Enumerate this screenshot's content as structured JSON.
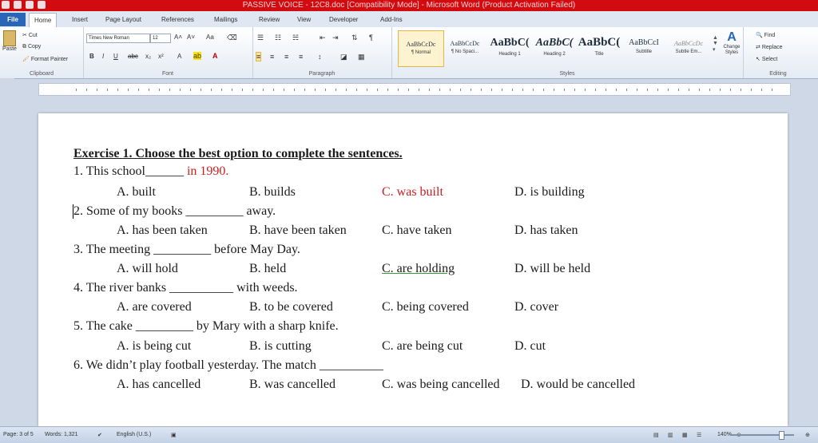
{
  "window": {
    "title": "PASSIVE VOICE - 12C8.doc [Compatibility Mode] - Microsoft Word (Product Activation Failed)"
  },
  "tabs": [
    "File",
    "Home",
    "Insert",
    "Page Layout",
    "References",
    "Mailings",
    "Review",
    "View",
    "Developer",
    "Add-Ins"
  ],
  "ribbon": {
    "clipboard": {
      "label": "Clipboard",
      "paste": "Paste",
      "cut": "Cut",
      "copy": "Copy",
      "format_painter": "Format Painter"
    },
    "font": {
      "label": "Font",
      "font_name": "Times New Roman",
      "font_size": "12"
    },
    "paragraph": {
      "label": "Paragraph"
    },
    "styles": {
      "label": "Styles",
      "items": [
        {
          "preview": "AaBbCcDc",
          "name": "¶ Normal"
        },
        {
          "preview": "AaBbCcDc",
          "name": "¶ No Spaci..."
        },
        {
          "preview": "AaBbC(",
          "name": "Heading 1"
        },
        {
          "preview": "AaBbC(",
          "name": "Heading 2"
        },
        {
          "preview": "AaBbC(",
          "name": "Title"
        },
        {
          "preview": "AaBbCcI",
          "name": "Subtitle"
        },
        {
          "preview": "AaBbCcDc",
          "name": "Subtle Em..."
        }
      ],
      "change_styles": "Change Styles"
    },
    "editing": {
      "label": "Editing",
      "find": "Find",
      "replace": "Replace",
      "select": "Select"
    }
  },
  "document": {
    "heading": "Exercise 1. Choose the best option to complete the sentences.",
    "questions": [
      {
        "stem": "1. This school",
        "blank": "______",
        "tail": " in 1990.",
        "options": [
          "A. built",
          "B. builds",
          "C. was built",
          "D. is building"
        ]
      },
      {
        "stem": "2. Some of my books",
        "blank": "_________",
        "tail": " away.",
        "options": [
          "A. has been taken",
          "B. have been taken",
          "C. have taken",
          "D. has taken"
        ]
      },
      {
        "stem": "3. The meeting",
        "blank": "_________",
        "tail": " before May Day.",
        "options": [
          "A. will hold",
          "B. held",
          "C. are holding",
          "D. will be held"
        ]
      },
      {
        "stem": "4. The river banks",
        "blank": "__________",
        "tail": " with weeds.",
        "options": [
          "A. are covered",
          "B. to be covered",
          "C. being covered",
          "D. cover"
        ]
      },
      {
        "stem": "5. The cake",
        "blank": "_________",
        "tail": " by Mary with a sharp knife.",
        "options": [
          "A. is being cut",
          "B. is cutting",
          "C. are being cut",
          "D. cut"
        ]
      },
      {
        "stem": "6. We didn’t play football yesterday. The match",
        "blank": "__________",
        "tail": "",
        "options": [
          "A. has cancelled",
          "B. was cancelled",
          "C. was being cancelled",
          "D. would be cancelled"
        ]
      }
    ]
  },
  "status": {
    "page": "Page: 3 of 5",
    "words": "Words: 1,321",
    "language": "English (U.S.)",
    "zoom": "140%"
  },
  "colors": {
    "title_bar": "#d20b10",
    "answer_red": "#cc1d1d"
  }
}
